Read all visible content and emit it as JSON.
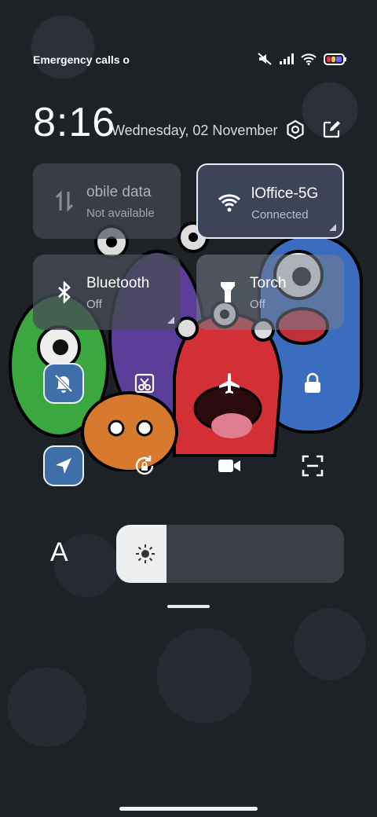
{
  "status_bar": {
    "carrier_text": "Emergency calls o",
    "icons": [
      "mute-icon",
      "signal-icon",
      "wifi-icon",
      "battery-icon"
    ]
  },
  "header": {
    "time": "8:16",
    "date": "Wednesday, 02 November",
    "buttons": [
      "settings-icon",
      "edit-icon"
    ]
  },
  "tiles": [
    {
      "id": "mobile-data",
      "title": "obile data",
      "subtitle": "Not available",
      "icon": "mobile-data-icon",
      "active": false
    },
    {
      "id": "wifi",
      "title": "lOffice-5G",
      "subtitle": "Connected",
      "icon": "wifi-icon",
      "active": true
    },
    {
      "id": "bluetooth",
      "title": "Bluetooth",
      "subtitle": "Off",
      "icon": "bluetooth-icon",
      "active": false
    },
    {
      "id": "torch",
      "title": "Torch",
      "subtitle": "Off",
      "icon": "torch-icon",
      "active": false
    }
  ],
  "quick_toggles": [
    {
      "name": "silent-toggle",
      "icon": "bell-off-icon",
      "active": true
    },
    {
      "name": "screenshot-toggle",
      "icon": "scissors-icon",
      "active": false
    },
    {
      "name": "airplane-toggle",
      "icon": "airplane-icon",
      "active": false
    },
    {
      "name": "lock-toggle",
      "icon": "lock-icon",
      "active": false
    },
    {
      "name": "location-toggle",
      "icon": "location-icon",
      "active": true
    },
    {
      "name": "rotation-toggle",
      "icon": "rotate-lock-icon",
      "active": false
    },
    {
      "name": "screen-record-toggle",
      "icon": "video-icon",
      "active": false
    },
    {
      "name": "scanner-toggle",
      "icon": "scan-icon",
      "active": false
    }
  ],
  "brightness": {
    "auto_label": "A",
    "level": 0.22,
    "icon": "sun-icon"
  },
  "colors": {
    "accent": "#3f6ea8",
    "tile": "#464c56",
    "active_tile": "#3a4658"
  }
}
